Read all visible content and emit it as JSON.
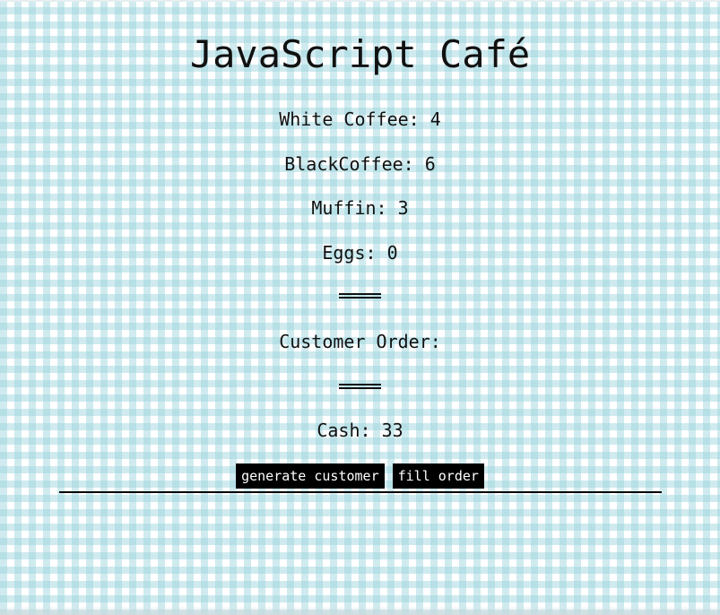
{
  "header": {
    "title": "JavaScript Café"
  },
  "inventory": {
    "white_coffee": "White Coffee: 4",
    "black_coffee": "BlackCoffee: 6",
    "muffin": "Muffin: 3",
    "eggs": "Eggs: 0"
  },
  "order": {
    "label": "Customer Order:"
  },
  "cash": {
    "label": "Cash: 33"
  },
  "controls": {
    "generate_label": "generate customer",
    "fill_label": "fill order"
  }
}
